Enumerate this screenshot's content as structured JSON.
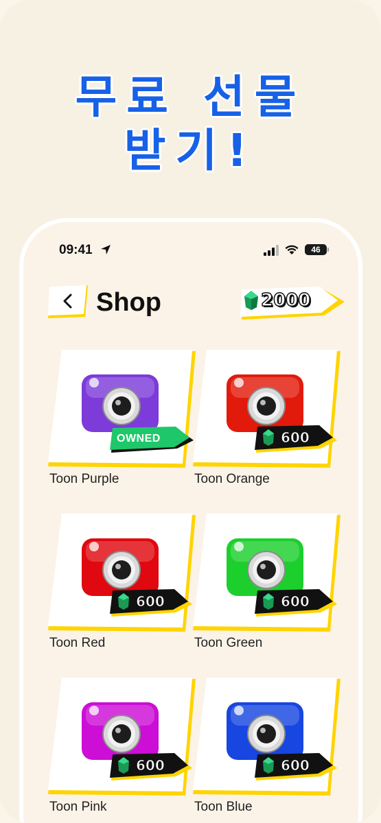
{
  "headline": {
    "line1": "무료 선물",
    "line2": "받기!"
  },
  "status_bar": {
    "time": "09:41",
    "battery": "46"
  },
  "header": {
    "title": "Shop",
    "gems": "2000"
  },
  "colors": {
    "accent": "#1761e6",
    "gem": "#16b56a",
    "owned": "#1ec86a",
    "highlight": "#ffd400"
  },
  "items": [
    {
      "name": "Toon Purple",
      "color": "#7d3bd9",
      "owned": true,
      "badge": "OWNED",
      "price": ""
    },
    {
      "name": "Toon Orange",
      "color": "#e21a0c",
      "owned": false,
      "badge": "",
      "price": "600"
    },
    {
      "name": "Toon Red",
      "color": "#e0090f",
      "owned": false,
      "badge": "",
      "price": "600"
    },
    {
      "name": "Toon Green",
      "color": "#1ccf2d",
      "owned": false,
      "badge": "",
      "price": "600"
    },
    {
      "name": "Toon Pink",
      "color": "#cc0ed6",
      "owned": false,
      "badge": "",
      "price": "600"
    },
    {
      "name": "Toon Blue",
      "color": "#1746e0",
      "owned": false,
      "badge": "",
      "price": "600"
    }
  ]
}
